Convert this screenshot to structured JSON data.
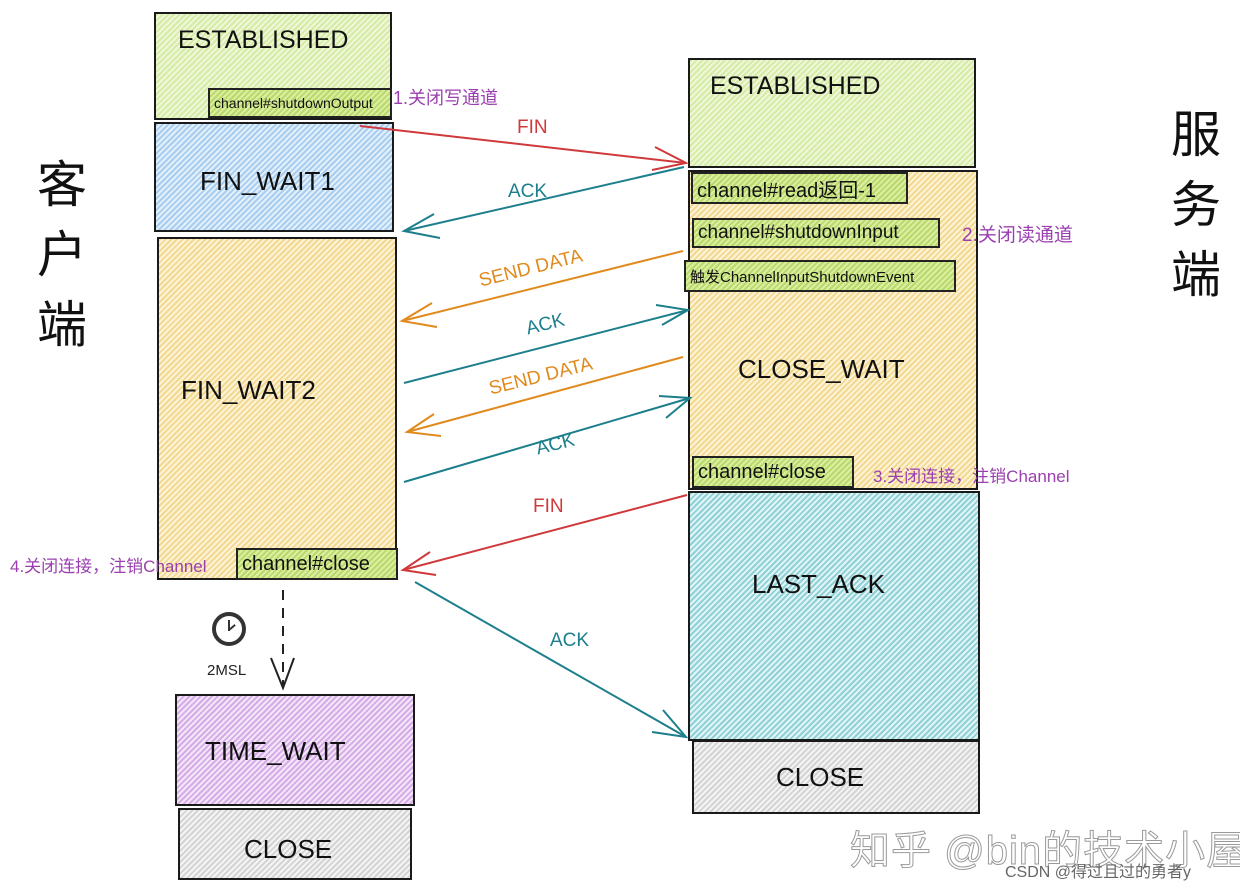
{
  "sides": {
    "client": "客户端",
    "server": "服务端"
  },
  "client": {
    "states": {
      "established": "ESTABLISHED",
      "fin_wait1": "FIN_WAIT1",
      "fin_wait2": "FIN_WAIT2",
      "time_wait": "TIME_WAIT",
      "close": "CLOSE"
    },
    "tags": {
      "shutdown_output": "channel#shutdownOutput",
      "close": "channel#close"
    },
    "notes": {
      "step1": "1.关闭写通道",
      "step4": "4.关闭连接，注销Channel"
    },
    "timer": {
      "label": "2MSL",
      "icon": "clock-icon"
    }
  },
  "server": {
    "states": {
      "established": "ESTABLISHED",
      "close_wait": "CLOSE_WAIT",
      "last_ack": "LAST_ACK",
      "close": "CLOSE"
    },
    "tags": {
      "read": "channel#read返回-1",
      "shutdown_input": "channel#shutdownInput",
      "event": "触发ChannelInputShutdownEvent",
      "close": "channel#close"
    },
    "notes": {
      "step2": "2.关闭读通道",
      "step3": "3.关闭连接，注销Channel"
    }
  },
  "messages": [
    {
      "label": "FIN",
      "direction": "client-to-server",
      "color": "#d0393b"
    },
    {
      "label": "ACK",
      "direction": "server-to-client",
      "color": "#1d7f8c"
    },
    {
      "label": "SEND DATA",
      "direction": "server-to-client",
      "color": "#e08a1e"
    },
    {
      "label": "ACK",
      "direction": "client-to-server",
      "color": "#1d7f8c"
    },
    {
      "label": "SEND DATA",
      "direction": "server-to-client",
      "color": "#e08a1e"
    },
    {
      "label": "ACK",
      "direction": "client-to-server",
      "color": "#1d7f8c"
    },
    {
      "label": "FIN",
      "direction": "server-to-client",
      "color": "#d0393b"
    },
    {
      "label": "ACK",
      "direction": "client-to-server",
      "color": "#1d7f8c"
    }
  ],
  "watermark": {
    "primary": "知乎 @bin的技术小屋",
    "secondary": "CSDN @得过且过的勇者y"
  }
}
